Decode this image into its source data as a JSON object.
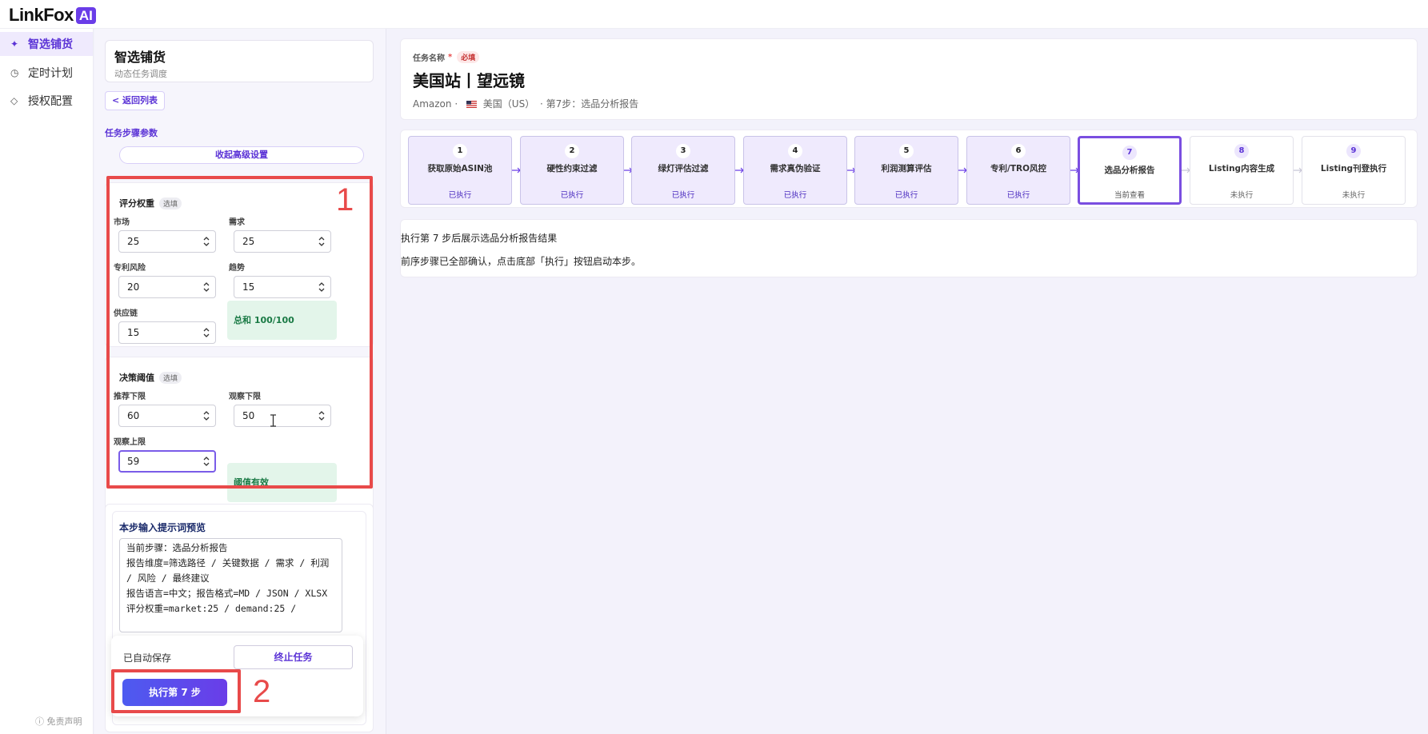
{
  "brand": {
    "name": "LinkFox",
    "badge": "AI"
  },
  "nav": {
    "items": [
      {
        "label": "智选铺货",
        "icon": "sparkle-icon",
        "active": true
      },
      {
        "label": "定时计划",
        "icon": "clock-icon",
        "active": false
      },
      {
        "label": "授权配置",
        "icon": "diamond-icon",
        "active": false
      }
    ],
    "disclaimer": "ⓘ 免责声明"
  },
  "panel": {
    "title": "智选铺货",
    "subtitle": "动态任务调度",
    "back_label": "< 返回列表",
    "section_label": "任务步骤参数",
    "collapse_label": "收起高级设置"
  },
  "weights": {
    "title": "评分权重",
    "tag": "选填",
    "market": {
      "label": "市场",
      "value": "25"
    },
    "demand": {
      "label": "需求",
      "value": "25"
    },
    "patent": {
      "label": "专利风险",
      "value": "20"
    },
    "trend": {
      "label": "趋势",
      "value": "15"
    },
    "supply": {
      "label": "供应链",
      "value": "15"
    },
    "sum_text": "总和 100/100"
  },
  "thresholds": {
    "title": "决策阈值",
    "tag": "选填",
    "rec_low": {
      "label": "推荐下限",
      "value": "60"
    },
    "obs_low": {
      "label": "观察下限",
      "value": "50"
    },
    "obs_high": {
      "label": "观察上限",
      "value": "59"
    },
    "valid_text": "阈值有效"
  },
  "annotations": {
    "box1": "1",
    "box2": "2"
  },
  "prompt": {
    "title": "本步输入提示词预览",
    "text": "当前步骤：选品分析报告\n报告维度=筛选路径 / 关键数据 / 需求 / 利润 / 风险 / 最终建议\n报告语言=中文；报告格式=MD / JSON / XLSX\n评分权重=market:25 / demand:25 /"
  },
  "actions": {
    "autosave": "已自动保存",
    "stop_label": "终止任务",
    "run_label": "执行第 7 步"
  },
  "task": {
    "name_label": "任务名称",
    "required_mark": "*",
    "required_tag": "必填",
    "name": "美国站丨望远镜",
    "platform": "Amazon ·",
    "country": "美国（US）",
    "step_info": "· 第7步：选品分析报告"
  },
  "steps": [
    {
      "num": "1",
      "title": "获取原始ASIN池",
      "status": "已执行",
      "state": "done"
    },
    {
      "num": "2",
      "title": "硬性约束过滤",
      "status": "已执行",
      "state": "done"
    },
    {
      "num": "3",
      "title": "绿灯评估过滤",
      "status": "已执行",
      "state": "done"
    },
    {
      "num": "4",
      "title": "需求真伪验证",
      "status": "已执行",
      "state": "done"
    },
    {
      "num": "5",
      "title": "利润测算评估",
      "status": "已执行",
      "state": "done"
    },
    {
      "num": "6",
      "title": "专利/TRO风控",
      "status": "已执行",
      "state": "done"
    },
    {
      "num": "7",
      "title": "选品分析报告",
      "status": "当前查看",
      "state": "current"
    },
    {
      "num": "8",
      "title": "Listing内容生成",
      "status": "未执行",
      "state": "pending"
    },
    {
      "num": "9",
      "title": "Listing刊登执行",
      "status": "未执行",
      "state": "pending"
    }
  ],
  "result": {
    "line1": "执行第 7 步后展示选品分析报告结果",
    "line2": "前序步骤已全部确认，点击底部「执行」按钮启动本步。"
  },
  "colors": {
    "accent": "#6a3de8",
    "annotation": "#e84a4a",
    "success_bg": "#e3f5ea"
  }
}
